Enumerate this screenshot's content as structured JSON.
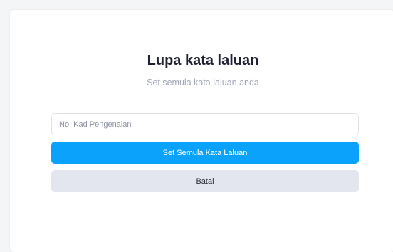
{
  "form": {
    "title": "Lupa kata laluan",
    "subtitle": "Set semula kata laluan anda",
    "ic_field": {
      "placeholder": "No. Kad Pengenalan",
      "value": ""
    },
    "reset_button_label": "Set Semula Kata Laluan",
    "cancel_button_label": "Batal"
  },
  "colors": {
    "primary": "#0aa2fb",
    "secondary": "#e3e6ee",
    "title": "#1f2233",
    "subtitle": "#a3a8b8"
  }
}
